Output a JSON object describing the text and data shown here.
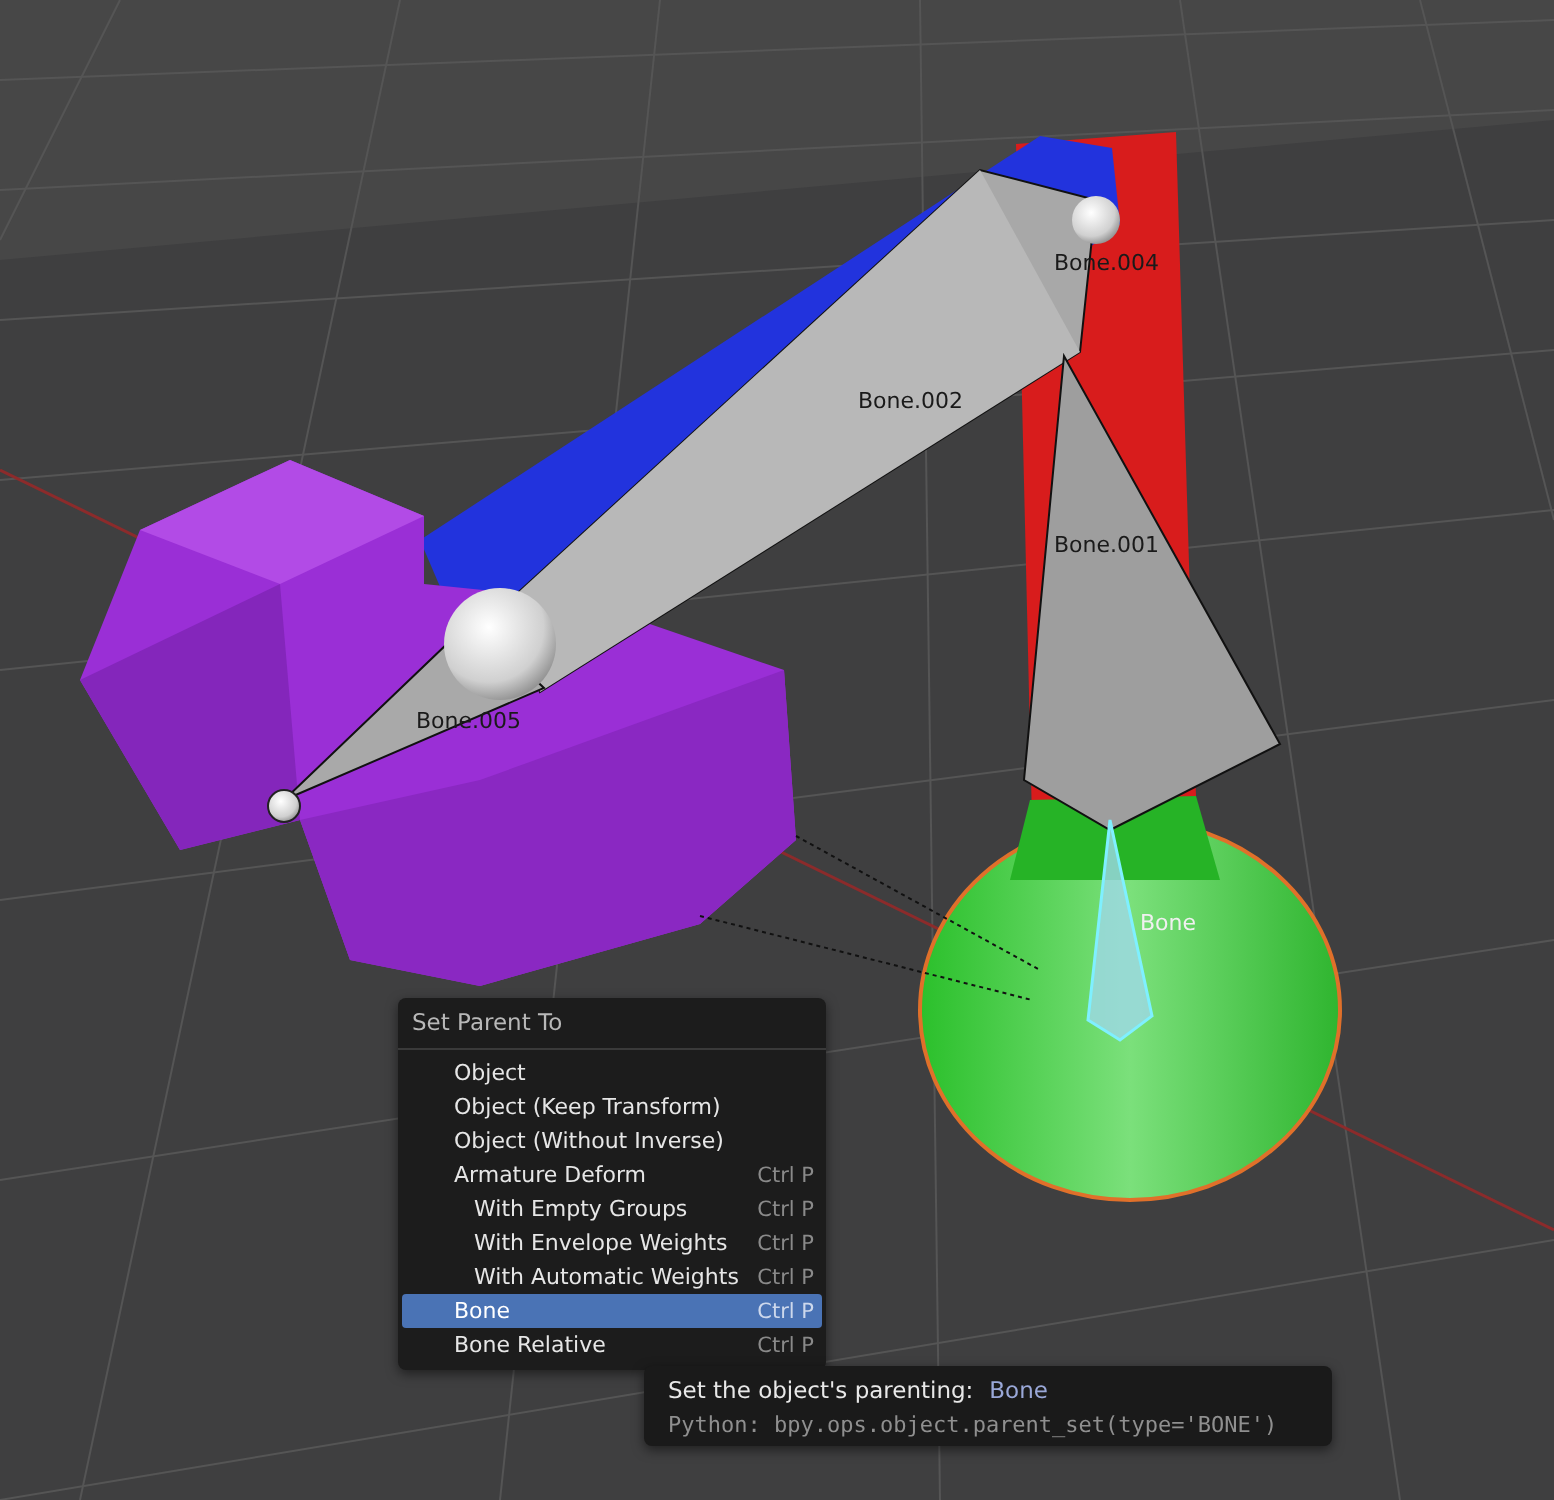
{
  "viewport": {
    "bone_labels": [
      {
        "text": "Bone.004",
        "kind": "normal"
      },
      {
        "text": "Bone.002",
        "kind": "normal"
      },
      {
        "text": "Bone.001",
        "kind": "normal"
      },
      {
        "text": "Bone.005",
        "kind": "normal"
      },
      {
        "text": "Bone",
        "kind": "active"
      }
    ]
  },
  "menu": {
    "title": "Set Parent To",
    "items": [
      {
        "label": "Object",
        "selected": false
      },
      {
        "label": "Object (Keep Transform)",
        "selected": false
      },
      {
        "label": "Object (Without Inverse)",
        "selected": false
      },
      {
        "label": "Armature Deform",
        "shortcut": "Ctrl P",
        "selected": false,
        "children": [
          {
            "label": "With Empty Groups",
            "shortcut": "Ctrl P",
            "selected": false
          },
          {
            "label": "With Envelope Weights",
            "shortcut": "Ctrl P",
            "selected": false
          },
          {
            "label": "With Automatic Weights",
            "shortcut": "Ctrl P",
            "selected": false
          }
        ]
      },
      {
        "label": "Bone",
        "shortcut": "Ctrl P",
        "selected": true
      },
      {
        "label": "Bone Relative",
        "shortcut": "Ctrl P",
        "selected": false
      }
    ]
  },
  "tooltip": {
    "description": "Set the object's parenting:",
    "value": "Bone",
    "python": "Python: bpy.ops.object.parent_set(type='BONE')"
  }
}
